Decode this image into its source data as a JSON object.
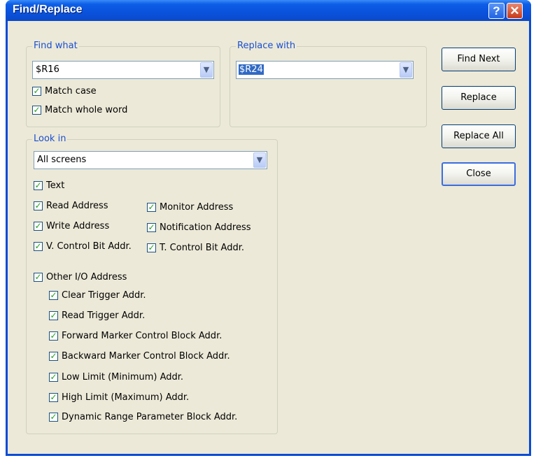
{
  "window": {
    "title": "Find/Replace",
    "help_label": "?",
    "close_label": "✕"
  },
  "find": {
    "legend": "Find what",
    "value": "$R16",
    "match_case": "Match case",
    "match_whole_word": "Match whole word"
  },
  "replace": {
    "legend": "Replace with",
    "value": "$R24"
  },
  "look_in": {
    "legend": "Look in",
    "scope": "All screens",
    "text": "Text",
    "read_address": "Read Address",
    "monitor_address": "Monitor Address",
    "write_address": "Write Address",
    "notification_address": "Notification Address",
    "v_control_bit": "V. Control Bit Addr.",
    "t_control_bit": "T. Control Bit Addr.",
    "other_io": "Other I/O Address",
    "clear_trigger": "Clear Trigger Addr.",
    "read_trigger": "Read Trigger Addr.",
    "forward_marker": "Forward Marker Control Block Addr.",
    "backward_marker": "Backward Marker Control Block Addr.",
    "low_limit": "Low Limit (Minimum) Addr.",
    "high_limit": "High Limit (Maximum) Addr.",
    "dynamic_range": "Dynamic Range Parameter Block Addr."
  },
  "buttons": {
    "find_next": "Find Next",
    "replace": "Replace",
    "replace_all": "Replace All",
    "close": "Close"
  },
  "icons": {
    "check": "✓",
    "dropdown": "▼"
  },
  "colors": {
    "accent": "#0a4bd6",
    "legend": "#1a4fd0",
    "dialog_bg": "#ece9d8"
  }
}
